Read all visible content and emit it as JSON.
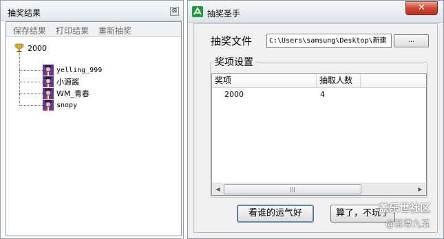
{
  "left_window": {
    "title": "抽奖结果",
    "close_glyph": "⊠",
    "menu": [
      "保存结果",
      "打印结果",
      "重新抽奖"
    ],
    "tree": {
      "root": "2000",
      "children": [
        "yelling_999",
        "小源酱",
        "WM_青春",
        "snopy"
      ]
    }
  },
  "right_window": {
    "title": "抽奖圣手",
    "close_glyph": "✕",
    "file_label": "抽奖文件",
    "file_path": "C:\\Users\\samsung\\Desktop\\新建",
    "browse_label": "...",
    "group_title": "奖项设置",
    "columns": [
      "奖项",
      "抽取人数"
    ],
    "rows": [
      [
        "2000",
        "4"
      ]
    ],
    "scroll_left": "◀",
    "scroll_right": "▶",
    "scroll_grip": "|||",
    "buttons": {
      "lucky": "看谁的运气好",
      "quit": "算了，不玩了"
    }
  },
  "watermark": {
    "line1": "盖乐世社区",
    "line2": "@至尊九五"
  },
  "icons": {
    "root": "trophy-icon",
    "child": "user-icon",
    "app": "app-icon"
  },
  "colors": {
    "accent": "#4a90d9",
    "close": "#c0301c",
    "app_icon": "#1a9e3b"
  }
}
